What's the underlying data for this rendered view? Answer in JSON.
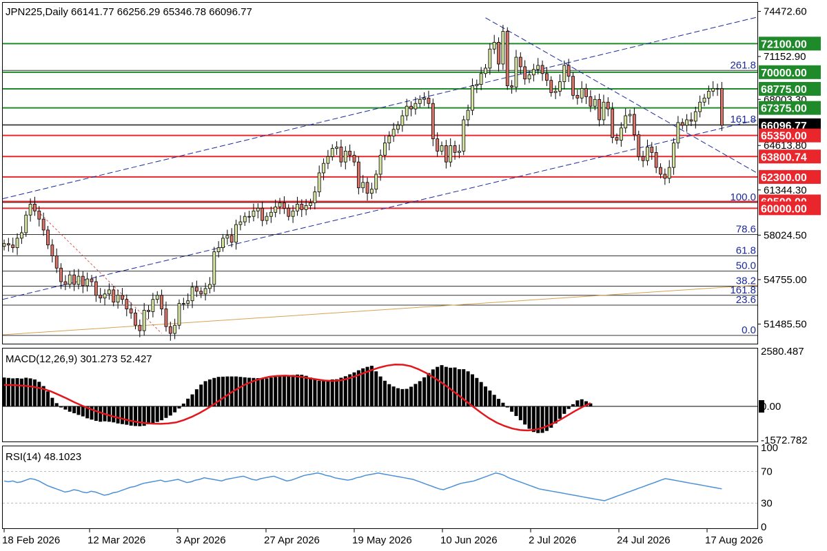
{
  "colors": {
    "bull": "#d6e6a2",
    "bear": "#d87368",
    "wick": "#000000",
    "green_level": "#1f8a2a",
    "red_level": "#e8262c",
    "channel": "#1a2a9c",
    "fib_line": "#333333",
    "fib_text": "#1a2a9c",
    "orange_trend": "#d9a050",
    "macd_hist": "#000000",
    "macd_signal": "#e3161c",
    "rsi_line": "#4a90d9",
    "price_tag_bg": "#000000"
  },
  "main_panel": {
    "header": "JPN225,Daily  66141.77 66256.29 65346.78 66096.77",
    "y_ticks": [
      "74472.60",
      "71152.90",
      "68003.30",
      "64613.80",
      "61344.30",
      "58024.50",
      "54755.00",
      "51485.50"
    ],
    "level_tags": [
      {
        "text": "72100.00",
        "value": 72100,
        "kind": "green"
      },
      {
        "text": "70000.00",
        "value": 70000,
        "kind": "green"
      },
      {
        "text": "68775.00",
        "value": 68775,
        "kind": "green"
      },
      {
        "text": "67375.00",
        "value": 67375,
        "kind": "green"
      },
      {
        "text": "66096.77",
        "value": 66096.77,
        "kind": "current"
      },
      {
        "text": "65350.00",
        "value": 65350,
        "kind": "red"
      },
      {
        "text": "63800.74",
        "value": 63800.74,
        "kind": "red"
      },
      {
        "text": "62300.00",
        "value": 62300,
        "kind": "red"
      },
      {
        "text": "60500.00",
        "value": 60500,
        "kind": "red"
      },
      {
        "text": "60000.00",
        "value": 60000,
        "kind": "red"
      }
    ],
    "fib_labels": [
      {
        "text": "261.8",
        "value": 70128
      },
      {
        "text": "161.8",
        "value": 66140
      },
      {
        "text": "100.0",
        "value": 60420
      },
      {
        "text": "78.6",
        "value": 58070
      },
      {
        "text": "61.8",
        "value": 56500
      },
      {
        "text": "50.0",
        "value": 55380
      },
      {
        "text": "38.2",
        "value": 54270
      },
      {
        "text": "161.8",
        "value": 53600
      },
      {
        "text": "23.6",
        "value": 52880
      },
      {
        "text": "0.0",
        "value": 50650
      }
    ]
  },
  "macd_panel": {
    "header": "MACD(12,26,9) 301.273 52.427",
    "y_ticks": [
      "2580.487",
      "0.00",
      "-1572.782"
    ]
  },
  "rsi_panel": {
    "header": "RSI(14) 48.1023",
    "y_ticks": [
      "100",
      "70",
      "30",
      "0"
    ],
    "levels": [
      70,
      30
    ]
  },
  "x_axis": {
    "labels": [
      "18 Feb 2026",
      "12 Mar 2026",
      "3 Apr 2026",
      "27 Apr 2026",
      "19 May 2026",
      "10 Jun 2026",
      "2 Jul 2026",
      "24 Jul 2026",
      "17 Aug 2026"
    ]
  },
  "chart_data": {
    "type": "candlestick",
    "symbol": "JPN225",
    "timeframe": "Daily",
    "ohlc_last": {
      "open": 66141.77,
      "high": 66256.29,
      "low": 65346.78,
      "close": 66096.77
    },
    "ylim": [
      50500,
      74800
    ],
    "close": [
      57400,
      57300,
      57100,
      57800,
      58200,
      59500,
      60300,
      59800,
      59200,
      58400,
      57300,
      56500,
      55600,
      54600,
      54400,
      55100,
      54400,
      55000,
      54300,
      54800,
      54600,
      53600,
      53400,
      53700,
      54000,
      53100,
      53600,
      53300,
      52600,
      52300,
      51400,
      51000,
      52500,
      52400,
      53300,
      53600,
      52600,
      51300,
      50800,
      51400,
      53000,
      53000,
      53200,
      54200,
      53900,
      53700,
      54100,
      54400,
      56800,
      57100,
      57800,
      58000,
      57500,
      58800,
      59000,
      59400,
      59400,
      59800,
      60000,
      59100,
      59400,
      59700,
      60100,
      60400,
      60000,
      59400,
      59800,
      60300,
      59900,
      60200,
      60400,
      61200,
      62600,
      63300,
      63800,
      64400,
      64500,
      63400,
      64200,
      63900,
      63400,
      61500,
      61900,
      61100,
      61400,
      62500,
      63900,
      64800,
      65300,
      65800,
      66100,
      66800,
      67500,
      67300,
      67700,
      68000,
      68100,
      67700,
      65100,
      64200,
      64600,
      63400,
      64600,
      64100,
      64200,
      66500,
      67200,
      69000,
      69100,
      69900,
      70300,
      71700,
      72200,
      70600,
      73000,
      69000,
      68900,
      71100,
      70400,
      69500,
      69800,
      70200,
      70500,
      69900,
      69400,
      68500,
      68600,
      69300,
      70500,
      69700,
      68300,
      68100,
      68800,
      68200,
      67500,
      68000,
      66500,
      67800,
      67300,
      65200,
      65000,
      65900,
      66800,
      66900,
      65400,
      63800,
      63500,
      64500,
      64100,
      63000,
      62500,
      62200,
      63000,
      64800,
      66300,
      66100,
      66500,
      66400,
      67100,
      67800,
      68100,
      68600,
      68800,
      68800,
      66100
    ],
    "macd": {
      "histogram": [
        1350,
        1330,
        1310,
        1320,
        1300,
        1340,
        1310,
        1260,
        1150,
        950,
        700,
        400,
        150,
        -50,
        -150,
        -250,
        -320,
        -400,
        -470,
        -560,
        -620,
        -680,
        -720,
        -700,
        -720,
        -750,
        -800,
        -830,
        -860,
        -900,
        -920,
        -930,
        -910,
        -840,
        -790,
        -730,
        -650,
        -540,
        -430,
        -280,
        -100,
        130,
        360,
        560,
        800,
        1020,
        1180,
        1260,
        1330,
        1380,
        1390,
        1400,
        1400,
        1400,
        1380,
        1360,
        1340,
        1330,
        1320,
        1310,
        1310,
        1350,
        1380,
        1400,
        1430,
        1460,
        1470,
        1490,
        1480,
        1430,
        1350,
        1260,
        1200,
        1190,
        1230,
        1260,
        1270,
        1340,
        1410,
        1500,
        1590,
        1690,
        1780,
        1850,
        1900,
        1640,
        1400,
        1200,
        1040,
        930,
        850,
        810,
        820,
        920,
        1050,
        1180,
        1360,
        1560,
        1730,
        1850,
        1930,
        1850,
        1810,
        1820,
        1740,
        1740,
        1640,
        1500,
        1330,
        1140,
        930,
        740,
        540,
        350,
        170,
        -50,
        -250,
        -450,
        -650,
        -850,
        -1050,
        -1200,
        -1250,
        -1240,
        -1150,
        -1000,
        -800,
        -580,
        -350,
        -120,
        100,
        280,
        330,
        240,
        140
      ],
      "signal": [
        1000,
        1000,
        980,
        950,
        900,
        820,
        700,
        540,
        370,
        190,
        30,
        -120,
        -250,
        -370,
        -480,
        -570,
        -660,
        -730,
        -780,
        -810,
        -820,
        -800,
        -750,
        -640,
        -490,
        -310,
        -100,
        140,
        390,
        640,
        860,
        1050,
        1200,
        1310,
        1390,
        1430,
        1440,
        1420,
        1380,
        1320,
        1260,
        1210,
        1190,
        1220,
        1300,
        1420,
        1560,
        1700,
        1820,
        1910,
        1960,
        1950,
        1880,
        1740,
        1560,
        1340,
        1100,
        830,
        550,
        260,
        -20,
        -300,
        -550,
        -760,
        -920,
        -1040,
        -1110,
        -1130,
        -1090,
        -990,
        -840,
        -650,
        -440,
        -220,
        -20,
        150
      ]
    },
    "rsi": [
      58,
      57,
      58,
      56,
      57,
      59,
      61,
      60,
      58,
      55,
      52,
      50,
      48,
      46,
      44,
      45,
      47,
      46,
      44,
      43,
      45,
      44,
      42,
      40,
      41,
      43,
      44,
      46,
      48,
      50,
      51,
      53,
      55,
      56,
      57,
      58,
      59,
      57,
      58,
      59,
      60,
      58,
      56,
      57,
      59,
      60,
      62,
      61,
      60,
      59,
      58,
      60,
      61,
      62,
      63,
      64,
      62,
      60,
      59,
      61,
      62,
      63,
      64,
      62,
      60,
      58,
      59,
      61,
      63,
      65,
      66,
      67,
      68,
      67,
      65,
      64,
      62,
      61,
      60,
      59,
      60,
      62,
      63,
      65,
      66,
      67,
      68,
      67,
      66,
      65,
      64,
      63,
      62,
      61,
      60,
      58,
      56,
      54,
      52,
      50,
      48,
      47,
      49,
      51,
      53,
      55,
      56,
      57,
      58,
      60,
      62,
      64,
      66,
      68,
      67,
      65,
      62,
      60,
      58,
      56,
      54,
      52,
      50,
      48,
      47,
      46,
      45,
      44,
      43,
      42,
      41,
      40,
      39,
      38,
      37,
      36,
      35,
      34,
      33,
      35,
      37,
      39,
      41,
      43,
      45,
      47,
      49,
      51,
      53,
      55,
      57,
      59,
      61,
      60,
      59,
      58,
      57,
      56,
      55,
      54,
      53,
      52,
      51,
      50,
      49,
      48
    ]
  }
}
